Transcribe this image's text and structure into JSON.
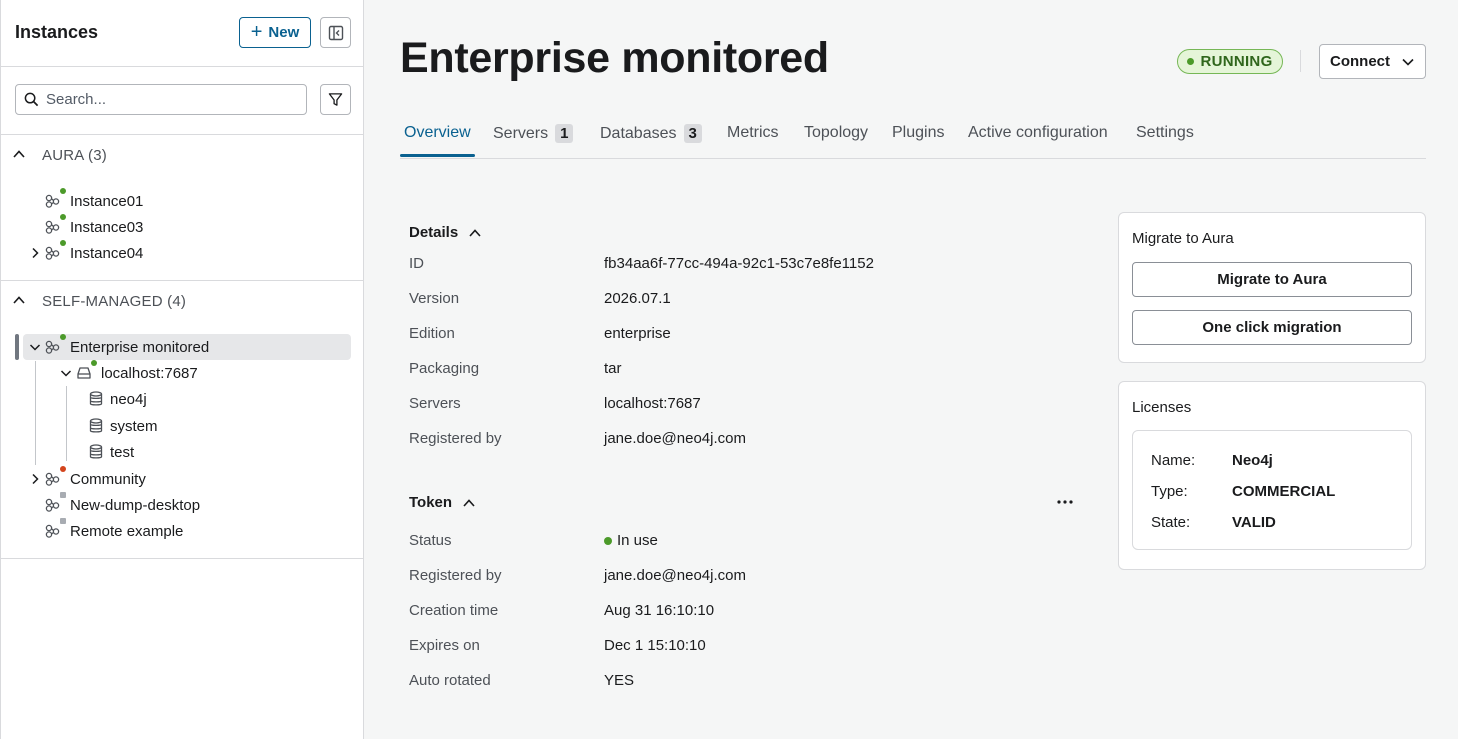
{
  "sidebar": {
    "title": "Instances",
    "new_label": "New",
    "search_placeholder": "Search...",
    "groups": [
      {
        "label": "AURA (3)"
      },
      {
        "label": "SELF-MANAGED (4)"
      }
    ],
    "aura_items": [
      "Instance01",
      "Instance03",
      "Instance04"
    ],
    "self_managed": {
      "selected": "Enterprise monitored",
      "server": "localhost:7687",
      "databases": [
        "neo4j",
        "system",
        "test"
      ],
      "others": [
        "Community",
        "New-dump-desktop",
        "Remote example"
      ]
    }
  },
  "main": {
    "title": "Enterprise monitored",
    "status": "RUNNING",
    "connect_label": "Connect",
    "tabs": [
      {
        "label": "Overview"
      },
      {
        "label": "Servers",
        "count": "1"
      },
      {
        "label": "Databases",
        "count": "3"
      },
      {
        "label": "Metrics"
      },
      {
        "label": "Topology"
      },
      {
        "label": "Plugins"
      },
      {
        "label": "Active configuration"
      },
      {
        "label": "Settings"
      }
    ],
    "details": {
      "title": "Details",
      "rows": [
        {
          "key": "ID",
          "value": "fb34aa6f-77cc-494a-92c1-53c7e8fe1152"
        },
        {
          "key": "Version",
          "value": "2026.07.1"
        },
        {
          "key": "Edition",
          "value": "enterprise"
        },
        {
          "key": "Packaging",
          "value": "tar"
        },
        {
          "key": "Servers",
          "value": "localhost:7687"
        },
        {
          "key": "Registered by",
          "value": "jane.doe@neo4j.com"
        }
      ]
    },
    "token": {
      "title": "Token",
      "rows": [
        {
          "key": "Status",
          "value": "In use"
        },
        {
          "key": "Registered by",
          "value": "jane.doe@neo4j.com"
        },
        {
          "key": "Creation time",
          "value": "Aug 31 16:10:10"
        },
        {
          "key": "Expires on",
          "value": "Dec 1 15:10:10"
        },
        {
          "key": "Auto rotated",
          "value": "YES"
        }
      ]
    },
    "migrate": {
      "title": "Migrate to Aura",
      "button1": "Migrate to Aura",
      "button2": "One click migration"
    },
    "licenses": {
      "title": "Licenses",
      "rows": [
        {
          "key": "Name:",
          "value": "Neo4j"
        },
        {
          "key": "Type:",
          "value": "COMMERCIAL"
        },
        {
          "key": "State:",
          "value": "VALID"
        }
      ]
    }
  },
  "colors": {
    "accent": "#0a6190",
    "running_green": "#4c9a2a",
    "offline_red": "#d3451d"
  }
}
